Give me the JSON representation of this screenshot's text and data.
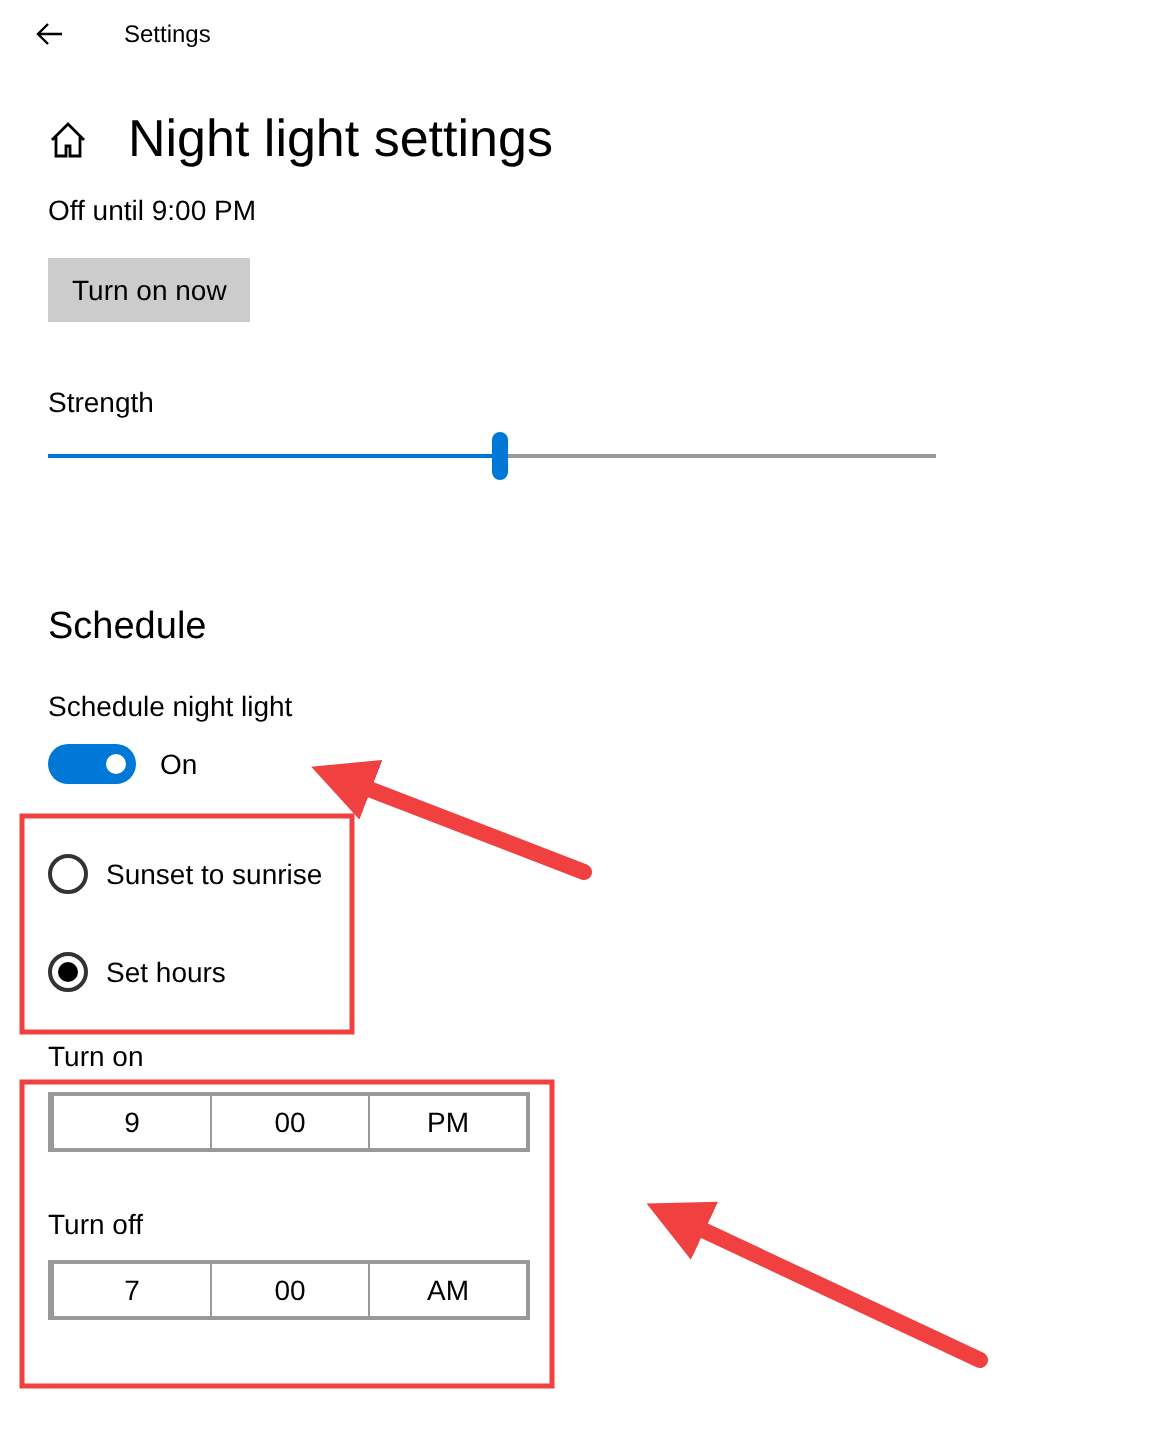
{
  "window": {
    "title": "Settings"
  },
  "page": {
    "title": "Night light settings",
    "status": "Off until 9:00 PM",
    "button": "Turn on now"
  },
  "strength": {
    "label": "Strength",
    "level": 0.51
  },
  "schedule": {
    "heading": "Schedule",
    "toggle_label": "Schedule night light",
    "on": true,
    "state_text": "On",
    "options": [
      {
        "label": "Sunset to sunrise",
        "selected": false
      },
      {
        "label": "Set hours",
        "selected": true
      }
    ],
    "times": [
      {
        "label": "Turn on",
        "hour": "9",
        "minute": "00",
        "period": "PM"
      },
      {
        "label": "Turn off",
        "hour": "7",
        "minute": "00",
        "period": "AM"
      }
    ]
  }
}
